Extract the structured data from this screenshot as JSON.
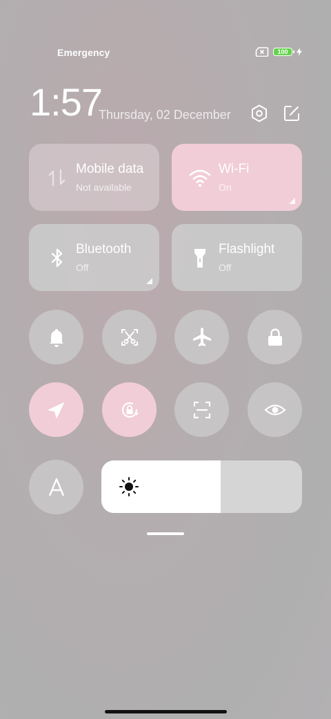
{
  "status_bar": {
    "carrier_text": "Emergency",
    "battery_level": "100"
  },
  "header": {
    "time": "1:57",
    "date": "Thursday, 02 December"
  },
  "tiles": [
    {
      "id": "mobile-data",
      "title": "Mobile data",
      "subtitle": "Not available",
      "icon": "mobile-data-icon",
      "active": false
    },
    {
      "id": "wifi",
      "title": "Wi-Fi",
      "subtitle": "On",
      "icon": "wifi-icon",
      "active": true
    },
    {
      "id": "bluetooth",
      "title": "Bluetooth",
      "subtitle": "Off",
      "icon": "bluetooth-icon",
      "active": false
    },
    {
      "id": "flashlight",
      "title": "Flashlight",
      "subtitle": "Off",
      "icon": "flashlight-icon",
      "active": false
    }
  ],
  "toggles": [
    {
      "id": "ring",
      "icon": "bell-icon",
      "active": false
    },
    {
      "id": "screenshot",
      "icon": "scissors-icon",
      "active": false
    },
    {
      "id": "airplane",
      "icon": "airplane-icon",
      "active": false
    },
    {
      "id": "lock",
      "icon": "lock-icon",
      "active": false
    },
    {
      "id": "location",
      "icon": "location-icon",
      "active": true
    },
    {
      "id": "rotation-lock",
      "icon": "rotation-lock-icon",
      "active": true
    },
    {
      "id": "scanner",
      "icon": "scan-icon",
      "active": false
    },
    {
      "id": "reading-mode",
      "icon": "eye-icon",
      "active": false
    },
    {
      "id": "auto-brightness",
      "icon": "letter-a-icon",
      "active": false
    }
  ],
  "brightness": {
    "level": 0.595,
    "icon": "sun-icon"
  },
  "colors": {
    "accent": "#f1cdd8",
    "tile": "#cdcccd",
    "battery": "#63d34b"
  }
}
